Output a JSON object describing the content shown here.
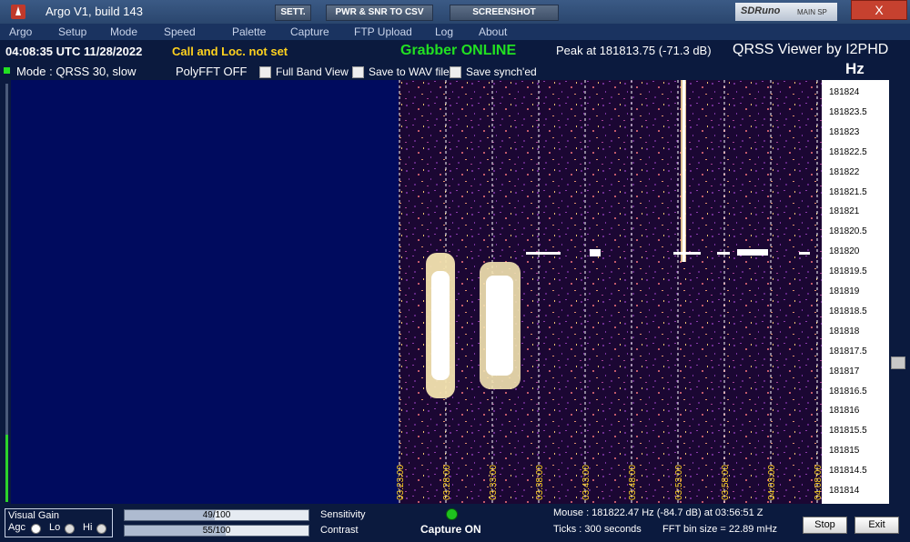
{
  "window": {
    "title": "Argo V1, build 143",
    "buttons": {
      "settings": "SETT.",
      "pwr_snr": "PWR & SNR TO CSV",
      "screenshot": "SCREENSHOT"
    },
    "sdruno": {
      "logo": "SDRuno",
      "sub": "MAIN SP"
    },
    "minimize": "_",
    "maximize": "□",
    "close": "X"
  },
  "menu": [
    "Argo",
    "Setup",
    "Mode",
    "Speed",
    "Palette",
    "Capture",
    "FTP Upload",
    "Log",
    "About"
  ],
  "status": {
    "time": "04:08:35 UTC  11/28/2022",
    "call_loc": "Call and Loc. not set",
    "grabber": "Grabber ONLINE",
    "peak": "Peak at  181813.75 (-71.3 dB)",
    "viewer": "QRSS Viewer by I2PHD",
    "unit": "Hz"
  },
  "options": {
    "mode": "Mode : QRSS 30, slow",
    "polyfft": "PolyFFT OFF",
    "full_band": "Full Band View",
    "save_wav": "Save to WAV file",
    "save_sync": "Save synch'ed"
  },
  "time_ticks": [
    "03:23:00",
    "03:28:00",
    "03:33:00",
    "03:38:00",
    "03:43:00",
    "03:48:00",
    "03:53:00",
    "03:58:00",
    "04:03:00",
    "04:08:00"
  ],
  "freq_labels": [
    "181824",
    "181823.5",
    "181823",
    "181822.5",
    "181822",
    "181821.5",
    "181821",
    "181820.5",
    "181820",
    "181819.5",
    "181819",
    "181818.5",
    "181818",
    "181817.5",
    "181817",
    "181816.5",
    "181816",
    "181815.5",
    "181815",
    "181814.5",
    "181814"
  ],
  "bottom": {
    "visual_gain": "Visual Gain",
    "agc": "Agc",
    "lo": "Lo",
    "hi": "Hi",
    "sensitivity_value": "49/100",
    "contrast_value": "55/100",
    "sensitivity_fraction": 0.49,
    "contrast_fraction": 0.55,
    "sensitivity_label": "Sensitivity",
    "contrast_label": "Contrast",
    "capture": "Capture ON",
    "mouse": "Mouse :   181822.47 Hz   (-84.7 dB) at 03:56:51 Z",
    "ticks": "Ticks   : 300 seconds",
    "fft_bin": "FFT bin size = 22.89 mHz",
    "stop": "Stop",
    "exit": "Exit"
  },
  "colors": {
    "accent_yellow": "#ffd21e",
    "grabber_green": "#22e022",
    "plot_background": "#000b5e",
    "signal": "#ffffff"
  }
}
